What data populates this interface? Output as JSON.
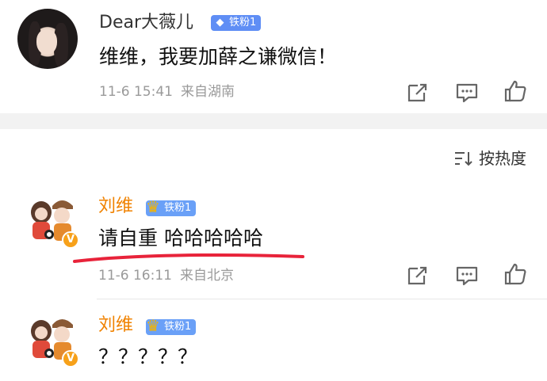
{
  "post": {
    "username": "Dear大薇儿",
    "badge": "铁粉1",
    "content": "维维，我要加薛之谦微信！",
    "time": "11-6 15:41",
    "location": "来自湖南"
  },
  "sort": {
    "label": "按热度"
  },
  "comments": [
    {
      "username": "刘维",
      "badge": "铁粉1",
      "content": "请自重 哈哈哈哈哈",
      "time": "11-6 16:11",
      "location": "来自北京"
    },
    {
      "username": "刘维",
      "badge": "铁粉1",
      "content": "？？？？？"
    }
  ],
  "icons": {
    "share": "share-icon",
    "comment": "comment-icon",
    "like": "thumbs-up-icon",
    "sort": "sort-icon",
    "verified": "verified-v-icon",
    "fan_badge": "diamond-icon",
    "crown": "crown-icon"
  },
  "verified_label": "V",
  "colors": {
    "username_highlight": "#f08200",
    "badge_blue": "#5f8ef5",
    "underline_red": "#e8233a",
    "meta_gray": "#9a9a9a"
  }
}
